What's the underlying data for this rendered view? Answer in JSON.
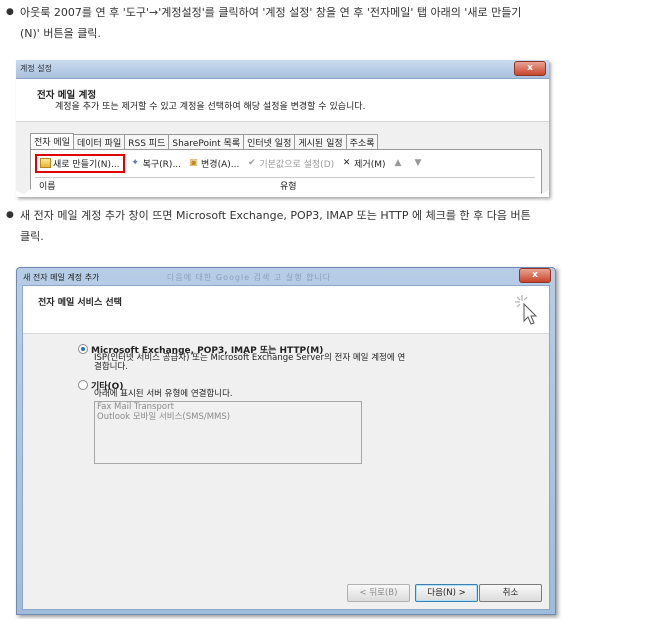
{
  "instructions": {
    "step1_line1": "아웃룩 2007를 연 후 '도구'→'계정설정'를 클릭하여 '계정 설정' 창을 연 후 '전자메일' 탭 아래의 '새로 만들기",
    "step1_line2": "(N)' 버튼을 클릭.",
    "step2_line1": "새 전자 메일 계정 추가 창이 뜨면 Microsoft Exchange, POP3, IMAP 또는 HTTP 에 체크를 한 후 다음 버튼",
    "step2_line2": "클릭."
  },
  "account_settings": {
    "window_title": "계정 설정",
    "close": "x",
    "header_title": "전자 메일 계정",
    "header_subtitle": "계정을 추가 또는 제거할 수 있고 계정을 선택하여 해당 설정을 변경할 수 있습니다.",
    "tabs": [
      {
        "label": "전자 메일"
      },
      {
        "label": "데이터 파일"
      },
      {
        "label": "RSS 피드"
      },
      {
        "label": "SharePoint 목록"
      },
      {
        "label": "인터넷 일정"
      },
      {
        "label": "게시된 일정"
      },
      {
        "label": "주소록"
      }
    ],
    "toolbar": {
      "new": "새로 만들기(N)...",
      "repair": "복구(R)...",
      "change": "변경(A)...",
      "set_default": "기본값으로 설정(D)",
      "remove": "제거(M)"
    },
    "list_headers": {
      "name": "이름",
      "type": "유형"
    }
  },
  "add_account": {
    "window_title": "새 전자 메일 계정 추가",
    "ghost_text": "다음에 대한 Google 검색 고 실행 합니다",
    "header_title": "전자 메일 서비스 선택",
    "option1_label": "Microsoft Exchange, POP3, IMAP 또는 HTTP(M)",
    "option1_desc_line1": "ISP(인터넷 서비스 공급자) 또는 Microsoft Exchange Server의 전자 메일 계정에 연",
    "option1_desc_line2": "결합니다.",
    "option2_label": "기타(O)",
    "option2_desc": "아래에 표시된 서버 유형에 연결합니다.",
    "server_types": [
      "Fax Mail Transport",
      "Outlook 모바일 서비스(SMS/MMS)"
    ],
    "buttons": {
      "back": "< 뒤로(B)",
      "next": "다음(N) >",
      "cancel": "취소"
    }
  }
}
